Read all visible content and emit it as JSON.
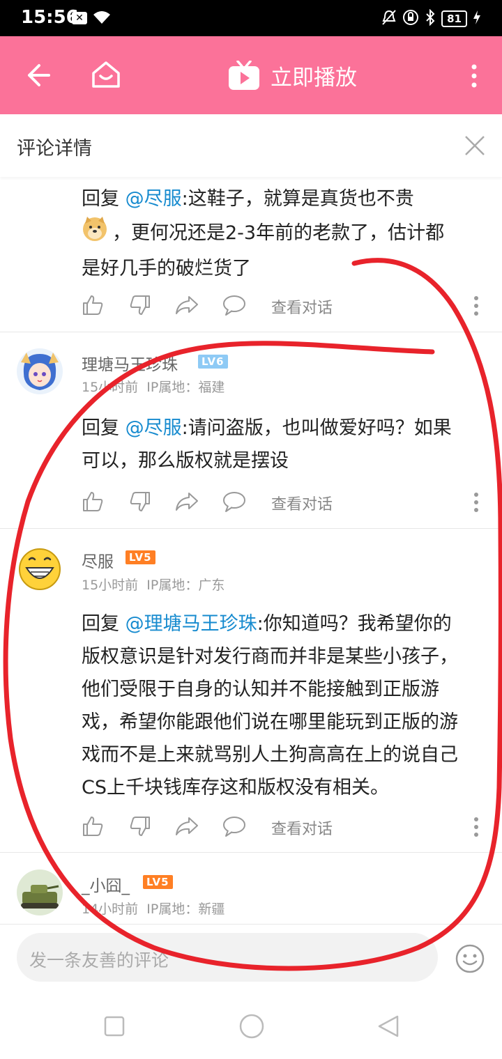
{
  "status_bar": {
    "time": "15:56",
    "battery": "81",
    "notification_badge": "✕"
  },
  "app_bar": {
    "play_label": "立即播放"
  },
  "detail_header": {
    "title": "评论详情"
  },
  "comments": [
    {
      "reply_prefix": "回复 ",
      "mention": "@尽服",
      "text_line1": ":这鞋子，就算是真货也不贵",
      "text_line2": "，更何况还是2-3年前的老款了，估计都",
      "text_line3": "是好几手的破烂货了",
      "view_conversation": "查看对话"
    },
    {
      "username": "理塘马王珍珠",
      "level": "LV6",
      "time": "15小时前",
      "ip_location": "IP属地：福建",
      "reply_prefix": "回复 ",
      "mention": "@尽服",
      "text_line1": ":请问盗版，也叫做爱好吗？如果",
      "text_line2": "可以，那么版权就是摆设",
      "view_conversation": "查看对话"
    },
    {
      "username": "尽服",
      "level": "LV5",
      "time": "15小时前",
      "ip_location": "IP属地：广东",
      "reply_prefix": "回复 ",
      "mention": "@理塘马王珍珠",
      "text_line1": ":你知道吗？我希望你的",
      "text_line2": "版权意识是针对发行商而并非是某些小孩子，",
      "text_line3": "他们受限于自身的认知并不能接触到正版游",
      "text_line4": "戏，希望你能跟他们说在哪里能玩到正版的游",
      "text_line5": "戏而不是上来就骂别人土狗高高在上的说自己",
      "text_line6": "CS上千块钱库存这和版权没有相关。",
      "view_conversation": "查看对话"
    },
    {
      "username": "_小囧_",
      "level": "LV5",
      "time": "14小时前",
      "ip_location": "IP属地：新疆"
    }
  ],
  "comment_input": {
    "placeholder": "发一条友善的评论"
  },
  "colors": {
    "brand_pink": "#fb7299",
    "mention_blue": "#178bcf",
    "level_orange": "#ff7f24",
    "annotation_red": "#e8232b"
  }
}
